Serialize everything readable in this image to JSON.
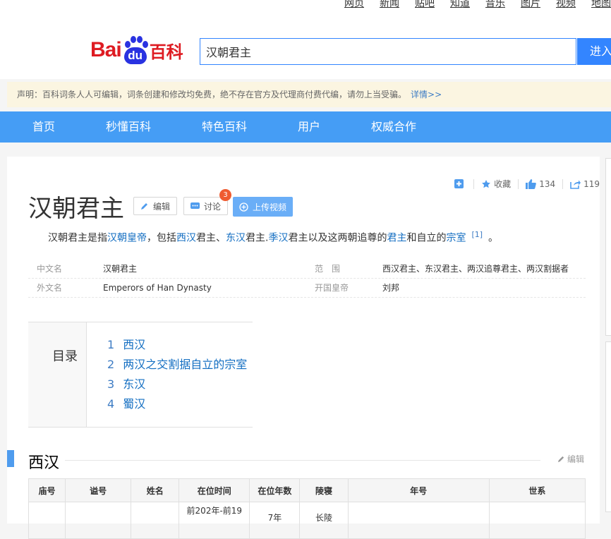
{
  "top_links": [
    "网页",
    "新闻",
    "贴吧",
    "知道",
    "音乐",
    "图片",
    "视频",
    "地图"
  ],
  "logo": {
    "left": "Bai",
    "paw": "du",
    "right": "百科"
  },
  "search": {
    "value": "汉朝君主",
    "button": "进入"
  },
  "notice": {
    "text": "声明：百科词条人人可编辑，词条创建和修改均免费，绝不存在官方及代理商付费代编，请勿上当受骗。",
    "link": "详情>>"
  },
  "nav": [
    "首页",
    "秒懂百科",
    "特色百科",
    "用户",
    "权威合作"
  ],
  "tools": {
    "collect": "收藏",
    "like_count": "134",
    "share_count": "119"
  },
  "title": "汉朝君主",
  "buttons": {
    "edit": "编辑",
    "discuss": "讨论",
    "discuss_badge": "3",
    "upload": "上传视频"
  },
  "summary": {
    "p1": "汉朝君主是指",
    "l1": "汉朝皇帝",
    "p2": "，包括",
    "l2": "西汉",
    "p3": "君主、",
    "l3": "东汉",
    "p4": "君主.",
    "l4": "季汉",
    "p5": "君主以及这两朝追尊的",
    "l5": "君主",
    "p6": "和自立的",
    "l6": "宗室",
    "ref": "[1]",
    "end": "。"
  },
  "basic_info": [
    {
      "k1": "中文名",
      "v1": "汉朝君主",
      "k2": "范　围",
      "v2": "西汉君主、东汉君主、两汉追尊君主、两汉割据者"
    },
    {
      "k1": "外文名",
      "v1": "Emperors of Han Dynasty",
      "k2": "开国皇帝",
      "v2": "刘邦"
    }
  ],
  "catalog": {
    "title": "目录",
    "items": [
      {
        "num": "1",
        "label": "西汉"
      },
      {
        "num": "2",
        "label": "两汉之交割据自立的宗室"
      },
      {
        "num": "3",
        "label": "东汉"
      },
      {
        "num": "4",
        "label": "蜀汉"
      }
    ]
  },
  "section": {
    "title": "西汉",
    "edit": "编辑"
  },
  "table": {
    "headers": [
      "庙号",
      "谥号",
      "姓名",
      "在位时间",
      "在位年数",
      "陵寝",
      "年号",
      "世系"
    ],
    "row1": [
      "",
      "",
      "",
      "前202年-前19",
      "7年",
      "长陵",
      "",
      ""
    ]
  },
  "colors": {
    "nav": "#459df5",
    "link": "#136ec2",
    "brand_red": "#de1b22",
    "brand_blue": "#2932e1"
  }
}
